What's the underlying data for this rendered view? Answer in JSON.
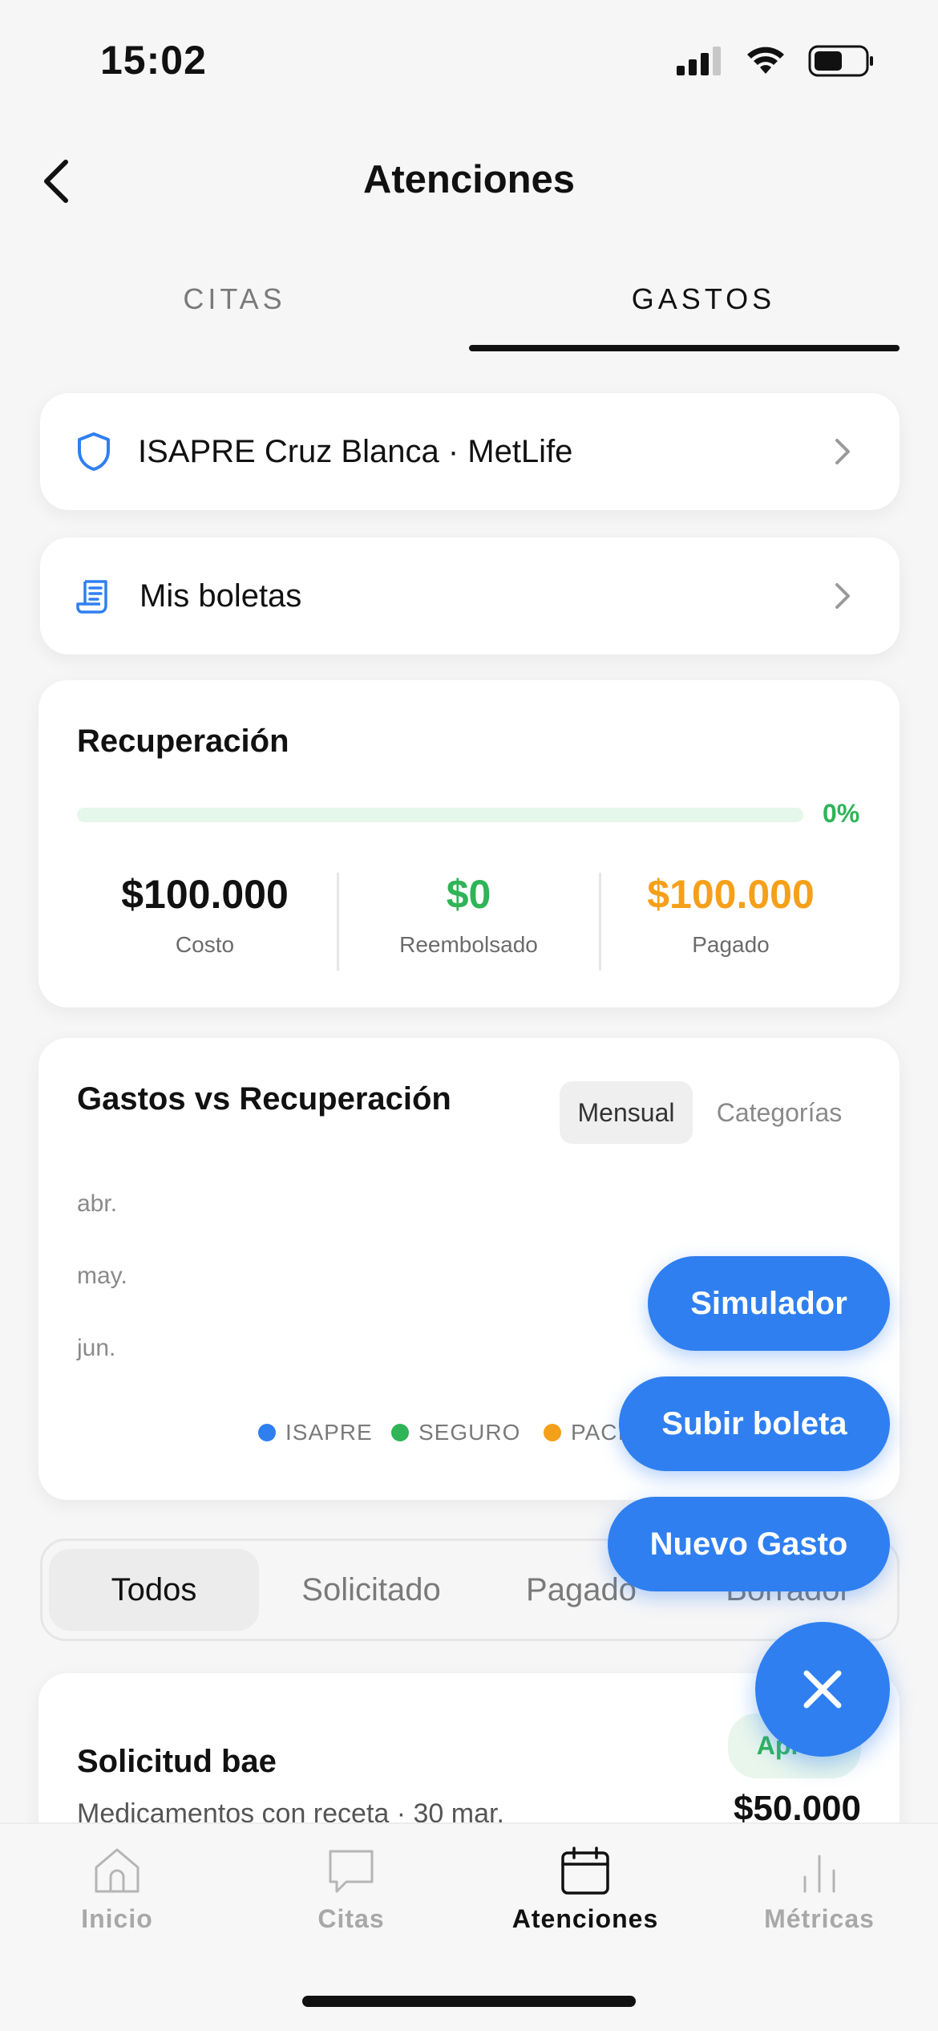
{
  "status_bar": {
    "time": "15:02"
  },
  "header": {
    "title": "Atenciones"
  },
  "tabs": [
    {
      "label": "CITAS",
      "active": false
    },
    {
      "label": "GASTOS",
      "active": true
    }
  ],
  "insurance_card": {
    "label": "ISAPRE Cruz Blanca · MetLife",
    "icon": "shield-icon"
  },
  "receipts_card": {
    "label": "Mis boletas",
    "icon": "receipt-icon"
  },
  "recovery": {
    "title": "Recuperación",
    "progress_value": 0,
    "progress_label": "0%",
    "stats": [
      {
        "value": "$100.000",
        "label": "Costo",
        "color": "#111111"
      },
      {
        "value": "$0",
        "label": "Reembolsado",
        "color": "#2fb457"
      },
      {
        "value": "$100.000",
        "label": "Pagado",
        "color": "#f5a01a"
      }
    ]
  },
  "chart_section": {
    "title": "Gastos vs Recuperación",
    "toggles": [
      {
        "label": "Mensual",
        "active": true
      },
      {
        "label": "Categorías",
        "active": false
      }
    ],
    "months": [
      "abr.",
      "may.",
      "jun."
    ],
    "legend": [
      {
        "label": "ISAPRE",
        "color": "#2f7ff0"
      },
      {
        "label": "SEGURO",
        "color": "#2fb457"
      },
      {
        "label": "PACI",
        "color": "#f5a01a"
      }
    ]
  },
  "filters": [
    {
      "label": "Todos",
      "active": true
    },
    {
      "label": "Solicitado",
      "active": false
    },
    {
      "label": "Pagado",
      "active": false
    },
    {
      "label": "Borrador",
      "active": false
    }
  ],
  "expense": {
    "title": "Solicitud bae",
    "subtitle": "Medicamentos con receta · 30 mar.",
    "amount": "$50.000",
    "status": "Aprob"
  },
  "fab_menu": {
    "simulator": "Simulador",
    "upload": "Subir boleta",
    "new_expense": "Nuevo Gasto"
  },
  "bottom_nav": [
    {
      "label": "Inicio",
      "icon": "home-icon",
      "active": false
    },
    {
      "label": "Citas",
      "icon": "chat-icon",
      "active": false
    },
    {
      "label": "Atenciones",
      "icon": "calendar-icon",
      "active": true
    },
    {
      "label": "Métricas",
      "icon": "bar-chart-icon",
      "active": false
    }
  ],
  "colors": {
    "accent": "#2f7ff0",
    "green": "#2fb457",
    "orange": "#f5a01a"
  }
}
